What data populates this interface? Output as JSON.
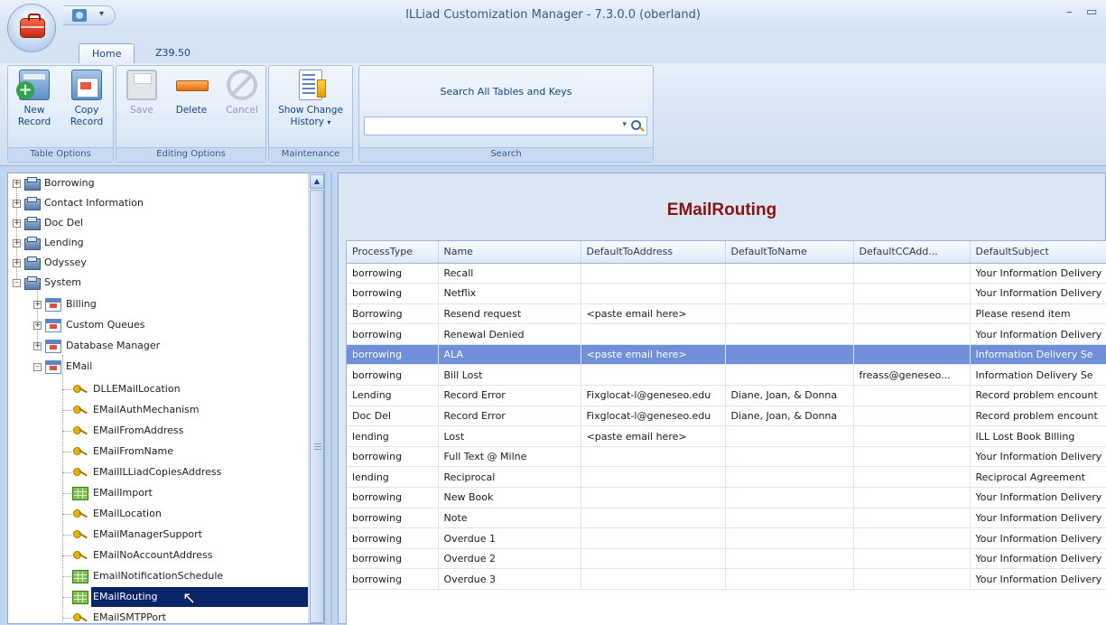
{
  "window": {
    "title": "ILLiad Customization Manager - 7.3.0.0 (oberland)",
    "minimize": "–",
    "maximize": "▭"
  },
  "tabs": [
    {
      "label": "Home",
      "active": true
    },
    {
      "label": "Z39.50",
      "active": false
    }
  ],
  "ribbon": {
    "groups": {
      "table_options": "Table Options",
      "editing_options": "Editing Options",
      "maintenance": "Maintenance",
      "search": "Search"
    },
    "buttons": {
      "new_record": [
        "New",
        "Record"
      ],
      "copy_record": [
        "Copy",
        "Record"
      ],
      "save": "Save",
      "delete": "Delete",
      "cancel": "Cancel",
      "show_change_history": [
        "Show Change",
        "History"
      ]
    },
    "search": {
      "title": "Search All Tables and Keys",
      "value": ""
    }
  },
  "tree": {
    "top_level": [
      "Borrowing",
      "Contact Information",
      "Doc Del",
      "Lending",
      "Odyssey",
      "System"
    ],
    "system_children": [
      "Billing",
      "Custom Queues",
      "Database Manager",
      "EMail"
    ],
    "email_children": [
      {
        "label": "DLLEMailLocation",
        "icon": "key-icon"
      },
      {
        "label": "EMailAuthMechanism",
        "icon": "key-icon"
      },
      {
        "label": "EMailFromAddress",
        "icon": "key-icon"
      },
      {
        "label": "EMailFromName",
        "icon": "key-icon"
      },
      {
        "label": "EMailILLiadCopiesAddress",
        "icon": "key-icon"
      },
      {
        "label": "EMailImport",
        "icon": "grid-icon"
      },
      {
        "label": "EMailLocation",
        "icon": "key-icon"
      },
      {
        "label": "EMailManagerSupport",
        "icon": "key-icon"
      },
      {
        "label": "EMailNoAccountAddress",
        "icon": "key-icon"
      },
      {
        "label": "EmailNotificationSchedule",
        "icon": "grid-icon"
      },
      {
        "label": "EMailRouting",
        "icon": "grid-icon",
        "selected": true
      },
      {
        "label": "EMailSMTPPort",
        "icon": "key-icon"
      }
    ]
  },
  "main": {
    "title": "EMailRouting",
    "columns": [
      "ProcessType",
      "Name",
      "DefaultToAddress",
      "DefaultToName",
      "DefaultCCAdd...",
      "DefaultSubject"
    ],
    "rows": [
      [
        "borrowing",
        "Recall",
        "",
        "",
        "",
        "Your Information Delivery"
      ],
      [
        "borrowing",
        "Netflix",
        "",
        "",
        "",
        "Your Information Delivery"
      ],
      [
        "Borrowing",
        "Resend request",
        "<paste email here>",
        "",
        "",
        "Please resend item"
      ],
      [
        "borrowing",
        "Renewal Denied",
        "",
        "",
        "",
        "Your Information Delivery"
      ],
      [
        "borrowing",
        "ALA",
        "<paste email here>",
        "",
        "",
        "Information Delivery Se"
      ],
      [
        "borrowing",
        "Bill Lost",
        "",
        "",
        "freass@geneseo...",
        "Information Delivery Se"
      ],
      [
        "Lending",
        "Record Error",
        "Fixglocat-l@geneseo.edu",
        "Diane, Joan, & Donna",
        "",
        "Record problem encount"
      ],
      [
        "Doc Del",
        "Record Error",
        "Fixglocat-l@geneseo.edu",
        "Diane, Joan, & Donna",
        "",
        "Record problem encount"
      ],
      [
        "lending",
        "Lost",
        "<paste email here>",
        "",
        "",
        "ILL Lost Book Billing"
      ],
      [
        "borrowing",
        "Full Text @ Milne",
        "",
        "",
        "",
        "Your Information Delivery"
      ],
      [
        "lending",
        "Reciprocal",
        "",
        "",
        "",
        "Reciprocal Agreement"
      ],
      [
        "borrowing",
        "New Book",
        "",
        "",
        "",
        "Your Information Delivery"
      ],
      [
        "borrowing",
        "Note",
        "",
        "",
        "",
        "Your Information Delivery"
      ],
      [
        "borrowing",
        "Overdue 1",
        "",
        "",
        "",
        "Your Information Delivery"
      ],
      [
        "borrowing",
        "Overdue 2",
        "",
        "",
        "",
        "Your Information Delivery"
      ],
      [
        "borrowing",
        "Overdue 3",
        "",
        "",
        "",
        "Your Information Delivery"
      ]
    ],
    "selected_row": 4
  },
  "colors": {
    "title_red": "#8a1212",
    "selection_blue": "#6f8fd8",
    "tree_selection": "#0a246a"
  }
}
